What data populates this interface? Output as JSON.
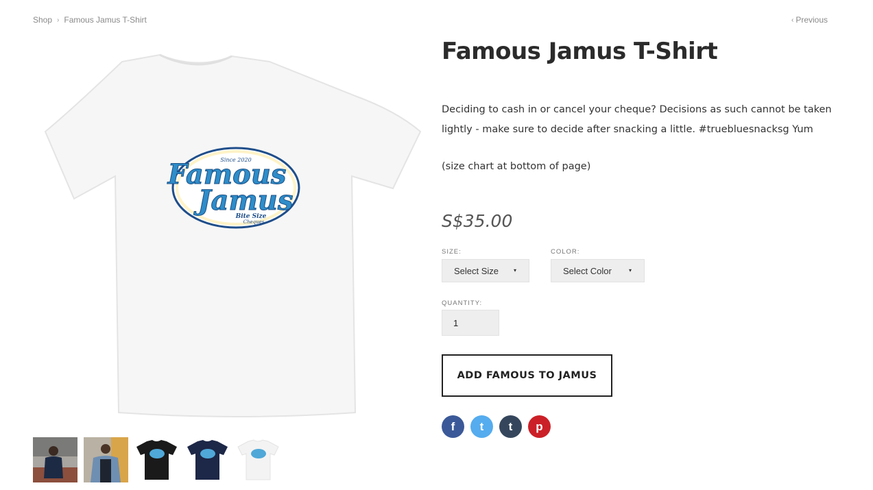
{
  "breadcrumb": {
    "shop": "Shop",
    "separator": "›",
    "current": "Famous Jamus T-Shirt"
  },
  "nav": {
    "previous_label": "Previous",
    "previous_chevron": "‹"
  },
  "product": {
    "title": "Famous Jamus T-Shirt",
    "description": "Deciding to cash in or cancel your cheque? Decisions as such cannot be taken lightly - make sure to decide after snacking a little. #truebluesnacksg Yum",
    "size_chart_note": "(size chart at bottom of page)",
    "price": "S$35.00",
    "logo": {
      "line1": "Famous",
      "line2": "Jamus",
      "since": "Since 2020",
      "tagline1": "Bite Size",
      "tagline2": "Cheques"
    }
  },
  "options": {
    "size_label": "SIZE:",
    "size_value": "Select Size",
    "color_label": "COLOR:",
    "color_value": "Select Color",
    "caret": "▾",
    "quantity_label": "QUANTITY:",
    "quantity_value": "1"
  },
  "add_to_cart_label": "ADD FAMOUS TO JAMUS",
  "thumbnails": [
    {
      "name": "photo-model-female"
    },
    {
      "name": "photo-model-male"
    },
    {
      "name": "black-tshirt"
    },
    {
      "name": "navy-tshirt"
    },
    {
      "name": "white-tshirt"
    }
  ],
  "share": [
    {
      "icon": "facebook-icon",
      "glyph": "f",
      "color": "#3b5998"
    },
    {
      "icon": "twitter-icon",
      "glyph": "t",
      "color": "#55acee"
    },
    {
      "icon": "tumblr-icon",
      "glyph": "t",
      "color": "#35465c"
    },
    {
      "icon": "pinterest-icon",
      "glyph": "p",
      "color": "#cb2027"
    }
  ]
}
